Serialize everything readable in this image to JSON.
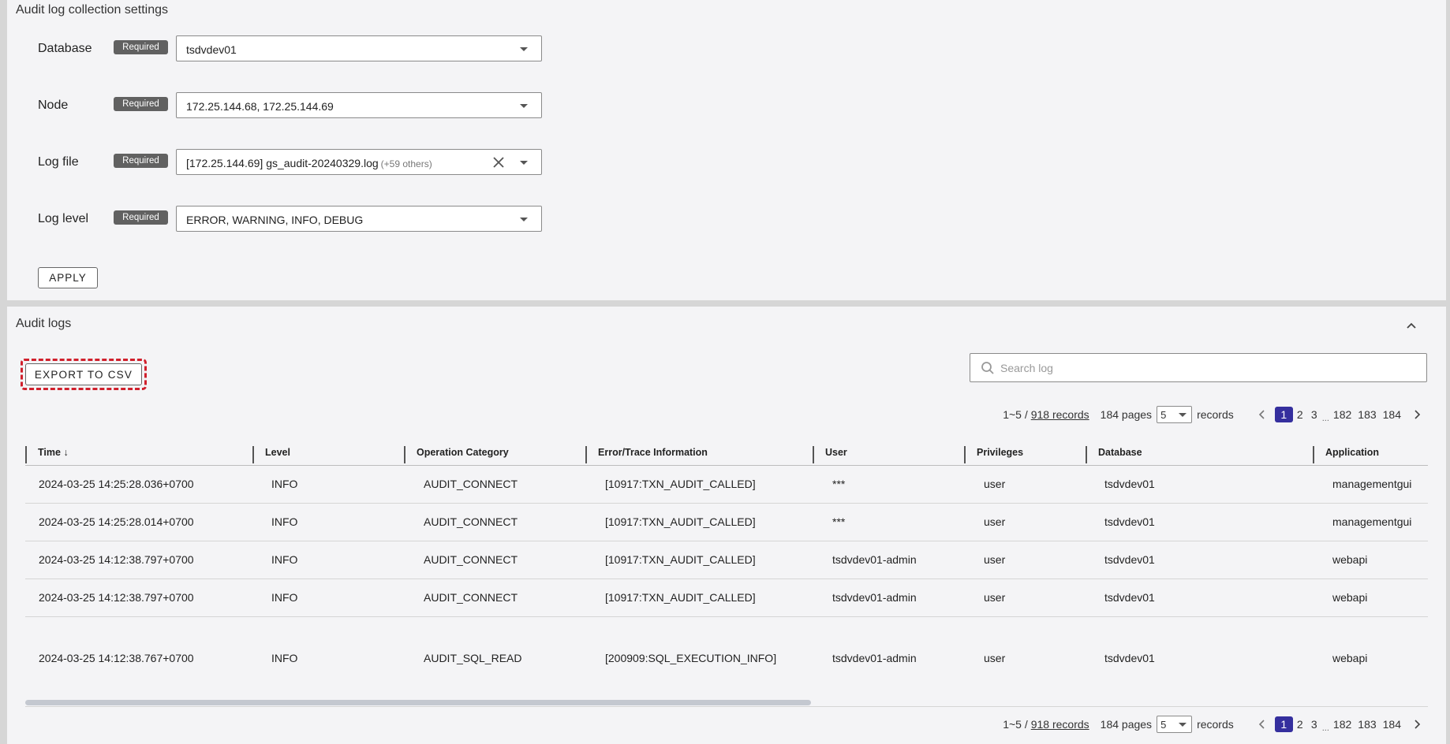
{
  "settings": {
    "title": "Audit log collection settings",
    "fields": [
      {
        "label": "Database",
        "badge": "Required",
        "value": "tsdvdev01",
        "extra": ""
      },
      {
        "label": "Node",
        "badge": "Required",
        "value": "172.25.144.68, 172.25.144.69",
        "extra": ""
      },
      {
        "label": "Log file",
        "badge": "Required",
        "value": "[172.25.144.69] gs_audit-20240329.log",
        "extra": "(+59 others)"
      },
      {
        "label": "Log level",
        "badge": "Required",
        "value": "ERROR, WARNING, INFO, DEBUG",
        "extra": ""
      }
    ],
    "apply_label": "APPLY"
  },
  "logs": {
    "title": "Audit logs",
    "export_label": "EXPORT TO CSV",
    "search_placeholder": "Search log",
    "pagination": {
      "range": "1~5 /",
      "records_link": "918 records",
      "pages": "184 pages",
      "page_size": "5",
      "records_word": "records",
      "pages_list": [
        "1",
        "2",
        "3",
        "182",
        "183",
        "184"
      ],
      "current_page": "1",
      "ellipsis": "..."
    },
    "columns": [
      "Time",
      "Level",
      "Operation Category",
      "Error/Trace Information",
      "User",
      "Privileges",
      "Database",
      "Application"
    ],
    "sort_indicator": "↓",
    "rows": [
      [
        "2024-03-25 14:25:28.036+0700",
        "INFO",
        "AUDIT_CONNECT",
        "[10917:TXN_AUDIT_CALLED]",
        "***",
        "user",
        "tsdvdev01",
        "managementgui"
      ],
      [
        "2024-03-25 14:25:28.014+0700",
        "INFO",
        "AUDIT_CONNECT",
        "[10917:TXN_AUDIT_CALLED]",
        "***",
        "user",
        "tsdvdev01",
        "managementgui"
      ],
      [
        "2024-03-25 14:12:38.797+0700",
        "INFO",
        "AUDIT_CONNECT",
        "[10917:TXN_AUDIT_CALLED]",
        "tsdvdev01-admin",
        "user",
        "tsdvdev01",
        "webapi"
      ],
      [
        "2024-03-25 14:12:38.797+0700",
        "INFO",
        "AUDIT_CONNECT",
        "[10917:TXN_AUDIT_CALLED]",
        "tsdvdev01-admin",
        "user",
        "tsdvdev01",
        "webapi"
      ],
      [
        "2024-03-25 14:12:38.767+0700",
        "INFO",
        "AUDIT_SQL_READ",
        "[200909:SQL_EXECUTION_INFO]",
        "tsdvdev01-admin",
        "user",
        "tsdvdev01",
        "webapi"
      ]
    ]
  },
  "colors": {
    "accent": "#352f9e",
    "required_badge": "#616161",
    "highlight_dash": "#d0202c"
  },
  "icons": [
    "chevron-down-icon",
    "close-icon",
    "chevron-up-icon",
    "search-icon",
    "arrow-down-icon",
    "chevron-left-icon",
    "chevron-right-icon"
  ]
}
